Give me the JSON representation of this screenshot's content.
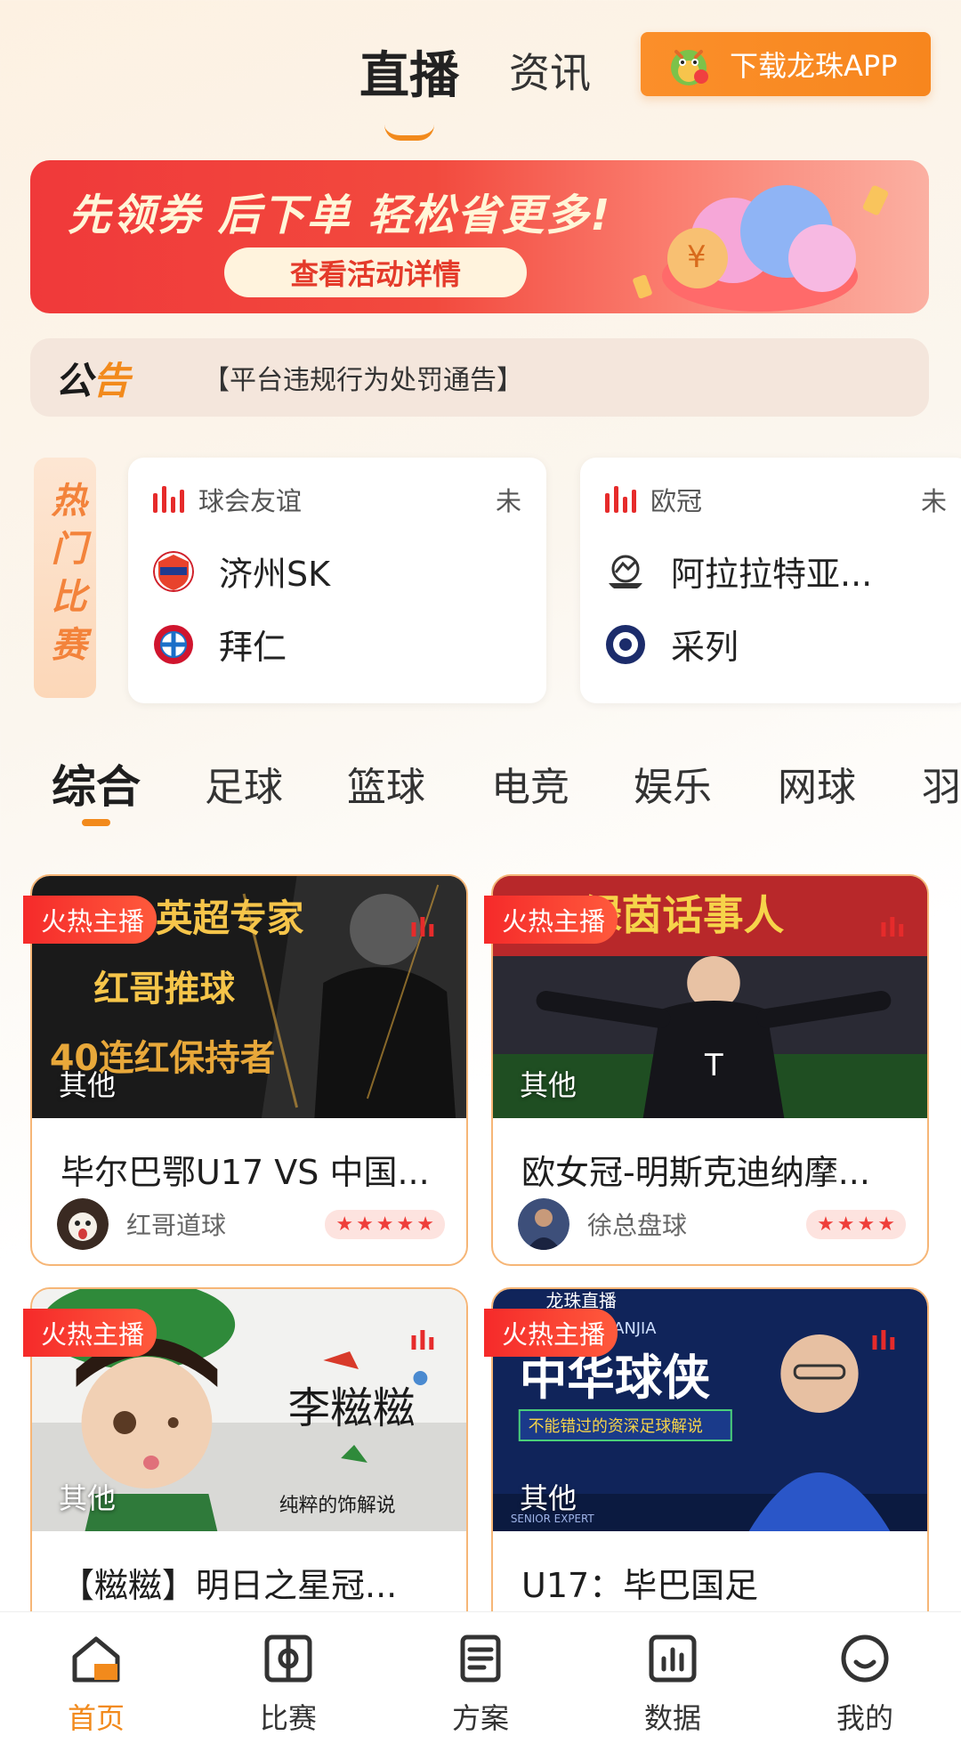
{
  "header": {
    "tabs": [
      {
        "label": "直播",
        "active": true
      },
      {
        "label": "资讯",
        "active": false
      }
    ],
    "download_button": "下载龙珠APP"
  },
  "banner": {
    "headline": "先领券 后下单 轻松省更多!",
    "cta": "查看活动详情"
  },
  "notice": {
    "logo_text": "公告",
    "text": "【平台违规行为处罚通告】"
  },
  "hot_matches": {
    "label": "热门比赛",
    "cards": [
      {
        "league": "球会友谊",
        "status": "未",
        "home": "济州SK",
        "away": "拜仁"
      },
      {
        "league": "欧冠",
        "status": "未",
        "home": "阿拉拉特亚...",
        "away": "采列"
      }
    ]
  },
  "categories": [
    "综合",
    "足球",
    "篮球",
    "电竞",
    "娱乐",
    "网球",
    "羽"
  ],
  "streams": [
    {
      "badge": "火热主播",
      "tag": "其他",
      "title": "毕尔巴鄂U17 VS 中国...",
      "host": "红哥道球",
      "stars": 5,
      "thumb_lines": [
        "英超专家",
        "红哥推球",
        "40连红保持者"
      ]
    },
    {
      "badge": "火热主播",
      "tag": "其他",
      "title": "欧女冠-明斯克迪纳摩...",
      "host": "徐总盘球",
      "stars": 4,
      "thumb_lines": [
        "绿茵话事人"
      ]
    },
    {
      "badge": "火热主播",
      "tag": "其他",
      "title": "【糍糍】明日之星冠...",
      "host": "",
      "stars": 0,
      "thumb_lines": [
        "李糍糍",
        "纯粹的饰解说"
      ]
    },
    {
      "badge": "火热主播",
      "tag": "其他",
      "title": "U17：毕巴国足",
      "host": "",
      "stars": 0,
      "thumb_lines": [
        "龙珠直播",
        "ZISHENZHUANJIA",
        "中华球侠",
        "不能错过的资深足球解说",
        "SENIOR EXPERT"
      ]
    }
  ],
  "bottom_nav": [
    {
      "label": "首页",
      "icon": "home-icon",
      "active": true
    },
    {
      "label": "比赛",
      "icon": "match-icon",
      "active": false
    },
    {
      "label": "方案",
      "icon": "plan-icon",
      "active": false
    },
    {
      "label": "数据",
      "icon": "data-icon",
      "active": false
    },
    {
      "label": "我的",
      "icon": "profile-icon",
      "active": false
    }
  ],
  "colors": {
    "accent": "#f28a1c",
    "live_red": "#e62b2b",
    "badge_red": "#f52a2a"
  }
}
